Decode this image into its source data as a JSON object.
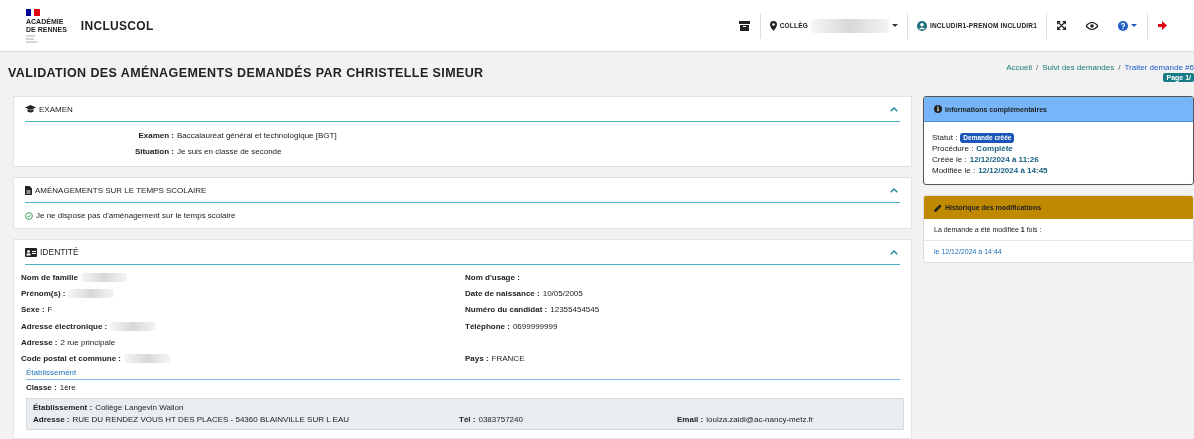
{
  "header": {
    "logo": {
      "line1": "ACADÉMIE",
      "line2": "DE RENNES"
    },
    "app_name": "INCLUSCOL",
    "establishment": "COLLÈG",
    "user": "INCLUDIR1-PRENOM INCLUDIR1"
  },
  "page_title": "VALIDATION DES AMÉNAGEMENTS DEMANDÉS PAR CHRISTELLE SIMEUR",
  "breadcrumb": [
    "Accueil",
    "Suivi des demandes",
    "Traiter demande #6"
  ],
  "breadcrumb_separator": "/",
  "page_badge": "Page 1/",
  "sections": [
    {
      "kind": "exam",
      "title": "EXAMEN",
      "expanded": true,
      "rows": [
        {
          "label": "Examen :",
          "value": "Baccalauréat général et technologique [BGT]"
        },
        {
          "label": "Situation :",
          "value": "Je suis en classe de seconde"
        }
      ]
    },
    {
      "kind": "check",
      "title": "AMÉNAGEMENTS SUR LE TEMPS SCOLAIRE",
      "expanded": true,
      "text": "Je ne dispose pas d'aménagement sur le temps scolaire"
    },
    {
      "kind": "identity",
      "title": "IDENTITÉ",
      "expanded": true,
      "left": [
        {
          "kind": "blurred",
          "label": "Nom de famille"
        },
        {
          "kind": "blurred",
          "label": "Prénom(s) :"
        },
        {
          "kind": "text",
          "label": "Sexe :",
          "value": "F"
        },
        {
          "kind": "blurred",
          "label": "Adresse électronique :"
        },
        {
          "kind": "text",
          "label": "Adresse :",
          "value": "2 rue principale"
        },
        {
          "kind": "blurred",
          "label": "Code postal et commune :"
        }
      ],
      "right": [
        {
          "kind": "label",
          "label": "Nom d'usage :"
        },
        {
          "kind": "text",
          "label": "Date de naissance :",
          "value": "10/05/2005"
        },
        {
          "kind": "text",
          "label": "Numéro du candidat :",
          "value": "12355454545"
        },
        {
          "kind": "text",
          "label": "Téléphone :",
          "value": "0699999999"
        },
        {
          "kind": "empty"
        },
        {
          "kind": "text",
          "label": "Pays :",
          "value": "FRANCE"
        }
      ],
      "subheading": "Établissement",
      "classe": {
        "label": "Classe :",
        "value": "1ère"
      },
      "school": {
        "name": {
          "label": "Établissement :",
          "value": "Collège Langevin Wallon"
        },
        "address": {
          "label": "Adresse :",
          "value": "RUE DU RENDEZ VOUS HT DES PLACES - 54360 BLAINVILLE SUR L EAU"
        },
        "phone": {
          "label": "Tél :",
          "value": "0383757240"
        },
        "email": {
          "label": "Email :",
          "value": "louiza.zaidi@ac-nancy-metz.fr"
        }
      }
    }
  ],
  "info": {
    "title": "Informations complémentaires",
    "status_label": "Statut :",
    "status": "Demande créée",
    "procedure_label": "Procédure :",
    "procedure": "Complète",
    "created_label": "Créée le :",
    "created": "12/12/2024 à 11:26",
    "modified_label": "Modifiée le :",
    "modified": "12/12/2024 à 14:45"
  },
  "history": {
    "title": "Historique des modifications",
    "summary": "La demande a été modifiée **1** fois :",
    "entries": [
      "le 12/12/2024 à 14:44"
    ]
  }
}
